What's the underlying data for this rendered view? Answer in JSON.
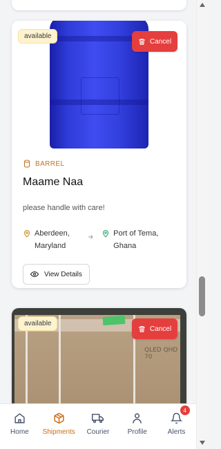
{
  "shipments": [
    {
      "status": "available",
      "cancel_label": "Cancel",
      "type": "BARREL",
      "name": "Maame Naa",
      "note": "please handle with care!",
      "from": "Aberdeen, Maryland",
      "to": "Port of Tema, Ghana",
      "view_label": "View Details",
      "image_icon": "barrel-photo"
    },
    {
      "status": "available",
      "cancel_label": "Cancel",
      "image_icon": "box-photo",
      "box_text": "QLED  QHD 70"
    }
  ],
  "nav": {
    "items": [
      {
        "label": "Home",
        "icon": "home-icon"
      },
      {
        "label": "Shipments",
        "icon": "package-icon",
        "active": true
      },
      {
        "label": "Courier",
        "icon": "truck-icon"
      },
      {
        "label": "Profile",
        "icon": "user-icon"
      },
      {
        "label": "Alerts",
        "icon": "bell-icon",
        "badge": "4"
      }
    ]
  },
  "colors": {
    "accent": "#c86d14",
    "danger": "#e53e3e",
    "badge_bg": "#fdf3cf"
  }
}
